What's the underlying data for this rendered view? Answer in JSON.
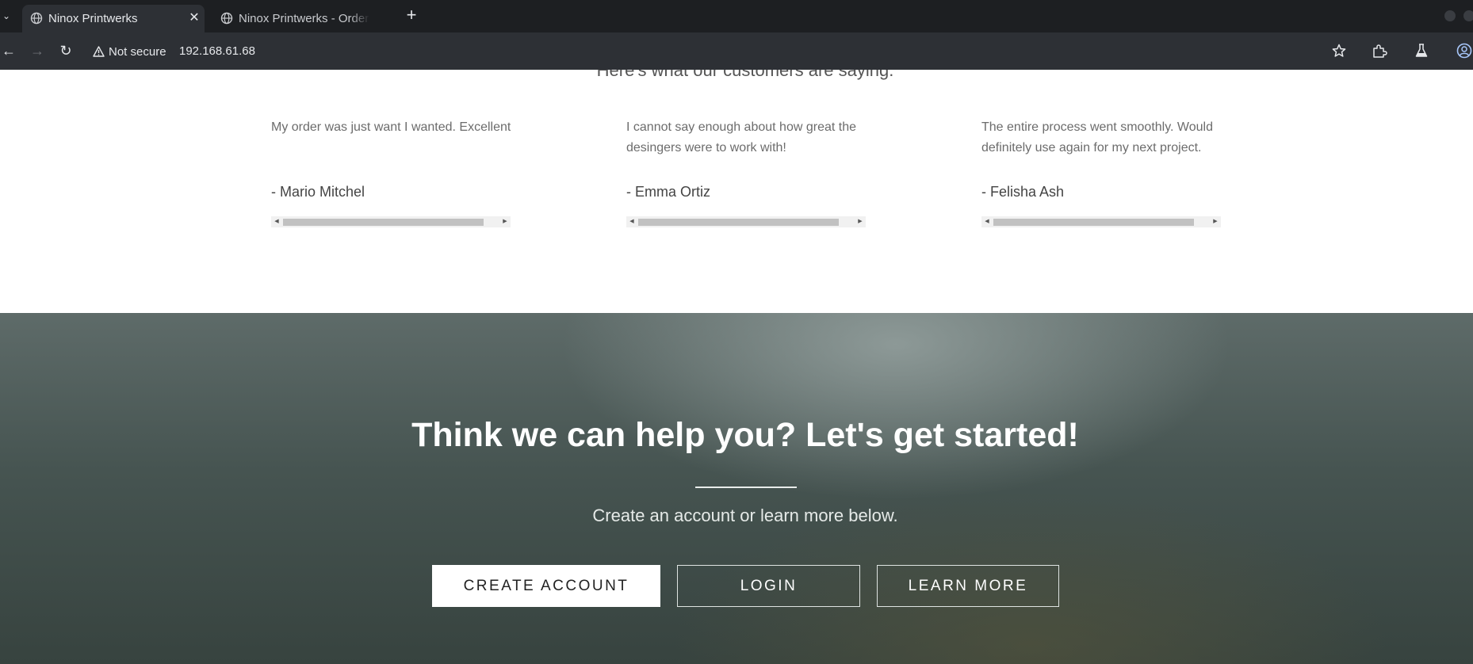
{
  "browser": {
    "tabs": [
      {
        "title": "Ninox Printwerks",
        "active": true
      },
      {
        "title": "Ninox Printwerks - Order",
        "active": false
      }
    ],
    "new_tab_label": "+",
    "security_label": "Not secure",
    "url": "192.168.61.68"
  },
  "page": {
    "section_heading": "Here's what our customers are saying.",
    "testimonials": [
      {
        "quote": "My order was just want I wanted. Excellent work.",
        "author": "- Mario Mitchel"
      },
      {
        "quote": "I cannot say enough about how great the desingers were to work with!",
        "author": "- Emma Ortiz"
      },
      {
        "quote": "The entire process went smoothly. Would definitely use again for my next project.",
        "author": "- Felisha Ash"
      }
    ],
    "cta": {
      "title": "Think we can help you? Let's get started!",
      "subtitle": "Create an account or learn more below.",
      "buttons": {
        "create": "CREATE ACCOUNT",
        "login": "LOGIN",
        "learn": "LEARN MORE"
      }
    }
  }
}
